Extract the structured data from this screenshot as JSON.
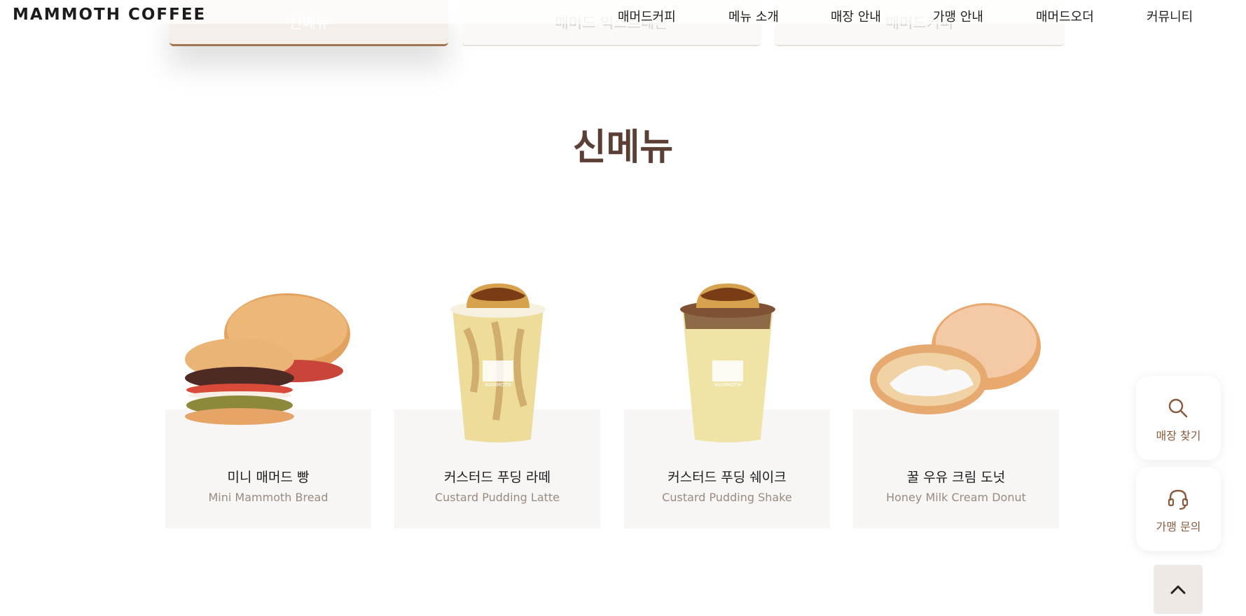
{
  "tabs": [
    {
      "label": "신메뉴"
    },
    {
      "label": "매머드 익스트레믄"
    },
    {
      "label": "매머드커피"
    }
  ],
  "header": {
    "logo": "MAMMOTH COFFEE",
    "nav": [
      "매머드커피",
      "메뉴 소개",
      "매장 안내",
      "가맹 안내",
      "매머드오더",
      "커뮤니티"
    ]
  },
  "section": {
    "title": "신메뉴"
  },
  "products": [
    {
      "name_ko": "미니 매머드 빵",
      "name_en": "Mini Mammoth Bread"
    },
    {
      "name_ko": "커스터드 푸딩 라떼",
      "name_en": "Custard Pudding Latte"
    },
    {
      "name_ko": "커스터드 푸딩 쉐이크",
      "name_en": "Custard Pudding Shake"
    },
    {
      "name_ko": "꿀 우유 크림 도넛",
      "name_en": "Honey Milk Cream Donut"
    }
  ],
  "floating": {
    "store_finder": {
      "label": "매장 찾기",
      "icon": "search-icon"
    },
    "franchise_inquiry": {
      "label": "가맹 문의",
      "icon": "headset-icon"
    },
    "back_to_top": {
      "icon": "chevron-up-icon"
    }
  },
  "colors": {
    "brand_brown": "#5b3f34",
    "accent": "#a0764f",
    "card_bg": "#f7f6f5"
  }
}
